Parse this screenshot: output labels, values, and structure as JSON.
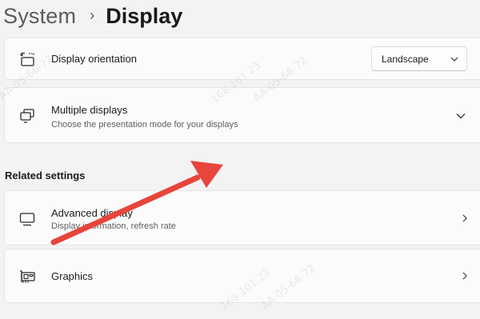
{
  "breadcrumb": {
    "parent": "System",
    "separator": "›",
    "current": "Display"
  },
  "display_orientation": {
    "title": "Display orientation",
    "icon": "display-orientation-icon",
    "selected": "Landscape"
  },
  "multiple_displays": {
    "title": "Multiple displays",
    "subtitle": "Choose the presentation mode for your displays",
    "icon": "multiple-displays-icon"
  },
  "related_settings": {
    "heading": "Related settings",
    "items": [
      {
        "title": "Advanced display",
        "subtitle": "Display information, refresh rate",
        "icon": "monitor-icon"
      },
      {
        "title": "Graphics",
        "icon": "graphics-card-icon"
      }
    ]
  },
  "watermark": {
    "ip": "168.101.23",
    "mac": "AA-05-66-72"
  },
  "colors": {
    "background": "#f3f3f3",
    "card": "#fbfbfb",
    "annotation_arrow": "#e8453c"
  }
}
